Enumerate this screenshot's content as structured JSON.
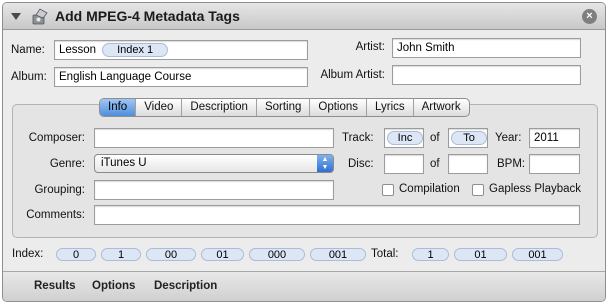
{
  "window": {
    "title": "Add MPEG-4 Metadata Tags",
    "close_glyph": "×"
  },
  "top": {
    "name_label": "Name:",
    "name_text": "Lesson",
    "name_token": "Index 1",
    "album_label": "Album:",
    "album_value": "English Language Course",
    "artist_label": "Artist:",
    "artist_value": "John Smith",
    "album_artist_label": "Album Artist:",
    "album_artist_value": ""
  },
  "tabs": [
    "Info",
    "Video",
    "Description",
    "Sorting",
    "Options",
    "Lyrics",
    "Artwork"
  ],
  "info": {
    "composer_label": "Composer:",
    "composer_value": "",
    "genre_label": "Genre:",
    "genre_value": "iTunes U",
    "grouping_label": "Grouping:",
    "grouping_value": "",
    "comments_label": "Comments:",
    "comments_value": "",
    "track_label": "Track:",
    "track_token_1": "Inc",
    "of_label": "of",
    "track_token_2": "To",
    "year_label": "Year:",
    "year_value": "2011",
    "disc_label": "Disc:",
    "disc_value": "",
    "disc_of_value": "",
    "bpm_label": "BPM:",
    "bpm_value": "",
    "compilation_label": "Compilation",
    "gapless_label": "Gapless Playback"
  },
  "index_row": {
    "index_label": "Index:",
    "index_tokens": [
      "0",
      "1",
      "00",
      "01",
      "000",
      "001"
    ],
    "total_label": "Total:",
    "total_tokens": [
      "1",
      "01",
      "001"
    ]
  },
  "bottom": {
    "results": "Results",
    "options": "Options",
    "description": "Description"
  }
}
